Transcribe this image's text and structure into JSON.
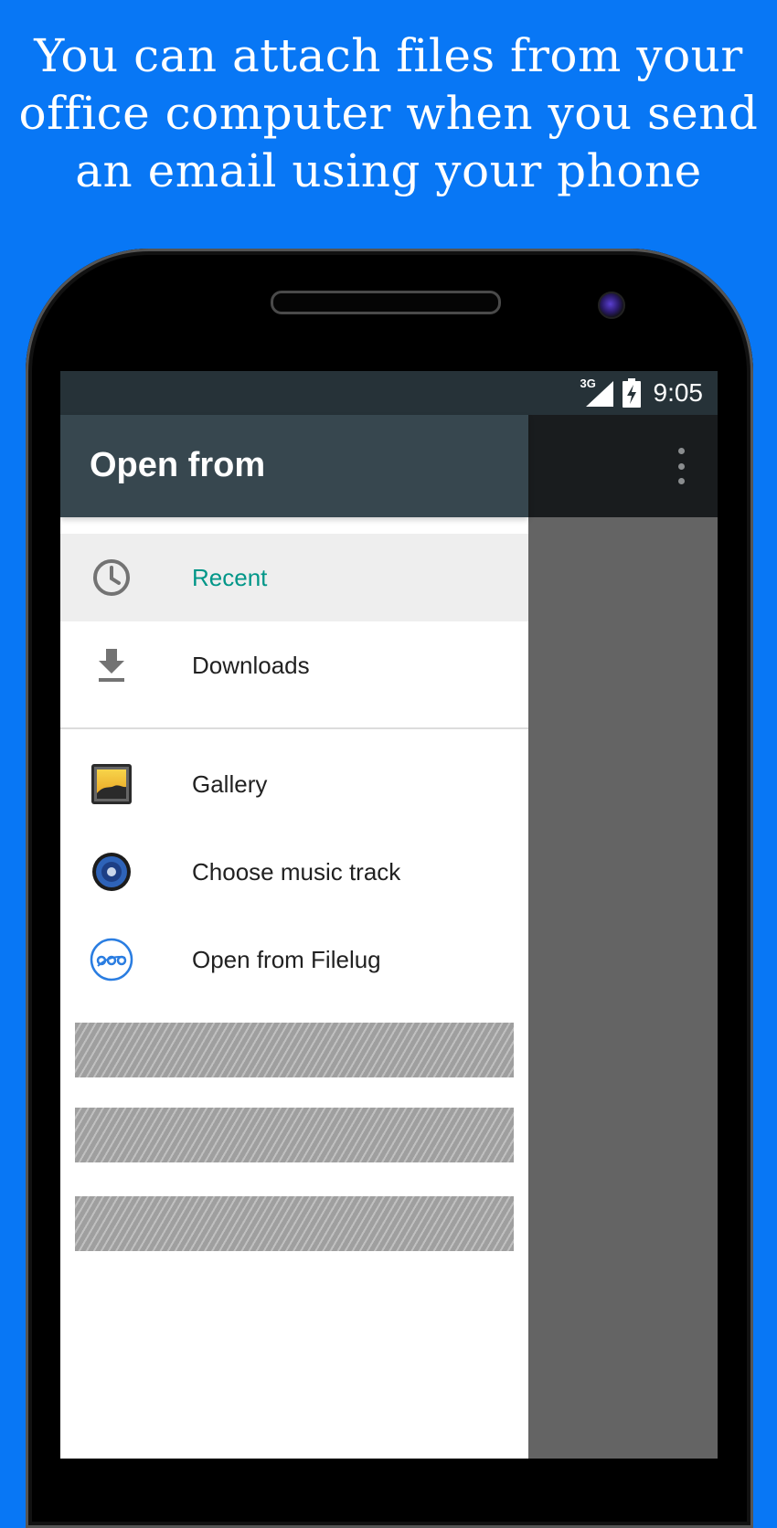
{
  "headline": "You can attach files from your office computer when you send an email using your phone",
  "status_bar": {
    "network": "3G",
    "time": "9:05"
  },
  "drawer": {
    "title": "Open from",
    "primary_items": [
      {
        "label": "Recent",
        "icon": "clock-icon",
        "selected": true
      },
      {
        "label": "Downloads",
        "icon": "download-icon",
        "selected": false
      }
    ],
    "app_items": [
      {
        "label": "Gallery",
        "icon": "gallery-icon"
      },
      {
        "label": "Choose music track",
        "icon": "music-speaker-icon"
      },
      {
        "label": "Open from Filelug",
        "icon": "filelug-icon"
      }
    ]
  },
  "colors": {
    "background": "#0877F5",
    "drawer_header": "#37474F",
    "status_bar": "#263238",
    "selected_text": "#009688",
    "scrim": "#646464"
  }
}
